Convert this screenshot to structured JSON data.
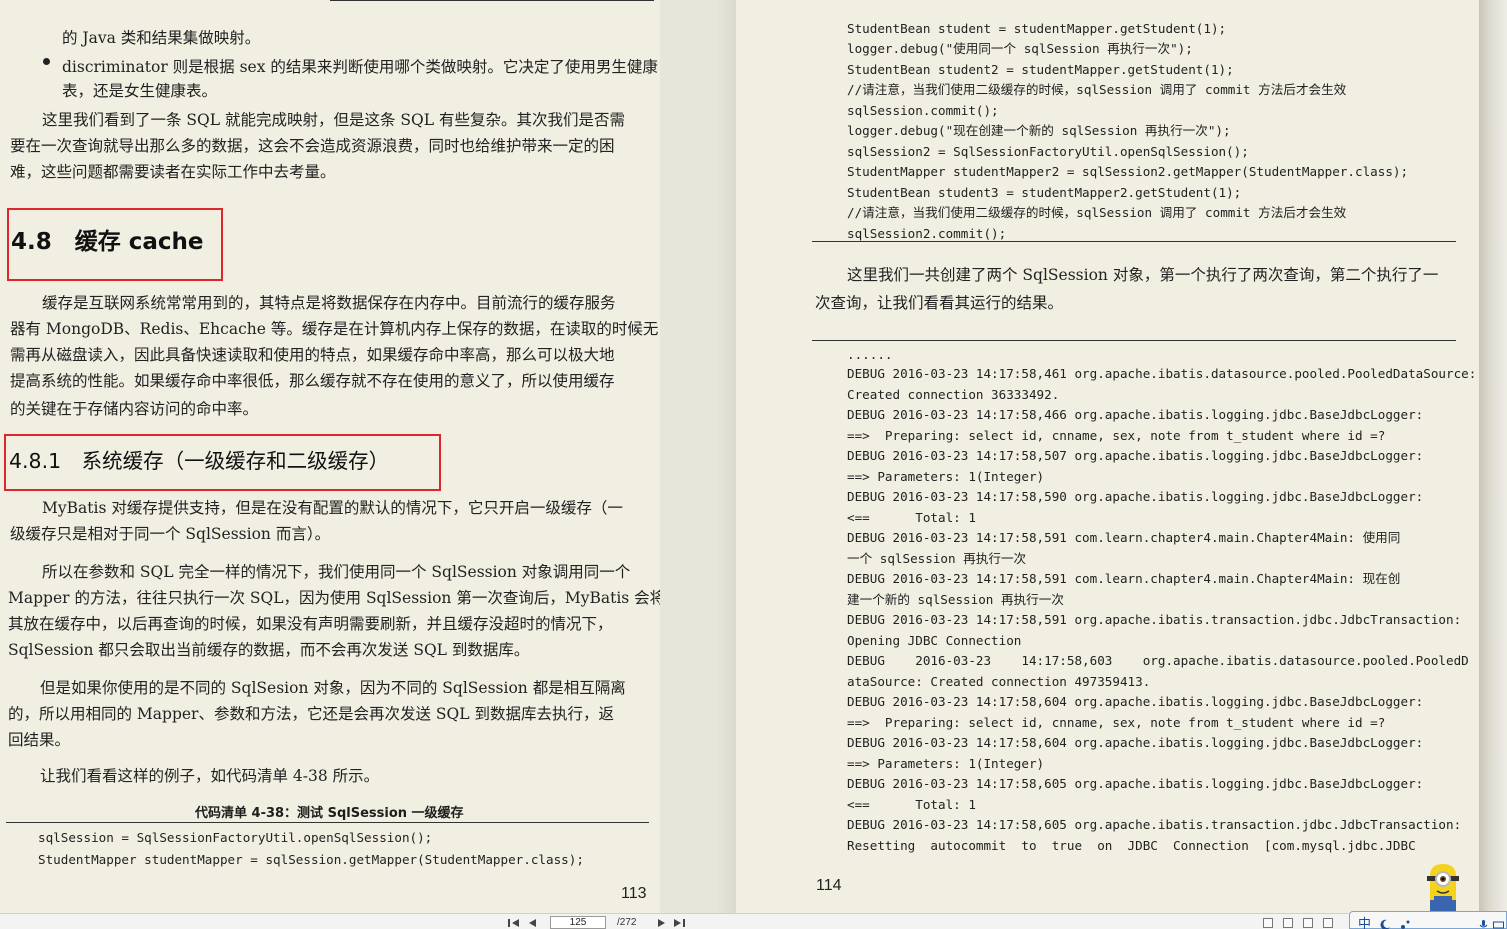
{
  "left_page": {
    "paragraphs": {
      "l1": "的 Java 类和结果集做映射。",
      "l2": "discriminator 则是根据 sex 的结果来判断使用哪个类做映射。它决定了使用男生健康",
      "l3": "表，还是女生健康表。",
      "l4": "这里我们看到了一条 SQL 就能完成映射，但是这条 SQL 有些复杂。其次我们是否需",
      "l5": "要在一次查询就导出那么多的数据，这会不会造成资源浪费，同时也给维护带来一定的困",
      "l6": "难，这些问题都需要读者在实际工作中去考量。",
      "l7": "缓存是互联网系统常常用到的，其特点是将数据保存在内存中。目前流行的缓存服务",
      "l8": "器有 MongoDB、Redis、Ehcache 等。缓存是在计算机内存上保存的数据，在读取的时候无",
      "l9": "需再从磁盘读入，因此具备快速读取和使用的特点，如果缓存命中率高，那么可以极大地",
      "l10": "提高系统的性能。如果缓存命中率很低，那么缓存就不存在使用的意义了，所以使用缓存",
      "l11": "的关键在于存储内容访问的命中率。",
      "l12": "MyBatis 对缓存提供支持，但是在没有配置的默认的情况下，它只开启一级缓存（一",
      "l13": "级缓存只是相对于同一个 SqlSession 而言）。",
      "l14": "所以在参数和 SQL 完全一样的情况下，我们使用同一个 SqlSession 对象调用同一个",
      "l15": "Mapper 的方法，往往只执行一次 SQL，因为使用 SqlSession 第一次查询后，MyBatis 会将",
      "l16": "其放在缓存中，以后再查询的时候，如果没有声明需要刷新，并且缓存没超时的情况下，",
      "l17": "SqlSession 都只会取出当前缓存的数据，而不会再次发送 SQL 到数据库。",
      "l18": "但是如果你使用的是不同的 SqlSesion 对象，因为不同的 SqlSession 都是相互隔离",
      "l19": "的，所以用相同的 Mapper、参数和方法，它还是会再次发送 SQL 到数据库去执行，返",
      "l20": "回结果。",
      "l21": "让我们看看这样的例子，如代码清单 4-38 所示。"
    },
    "heading_48": "4.8　缓存 cache",
    "heading_481": "4.8.1　系统缓存（一级缓存和二级缓存）",
    "caption": "代码清单 4-38：测试 SqlSession 一级缓存",
    "code": {
      "c1": "sqlSession = SqlSessionFactoryUtil.openSqlSession();",
      "c2": "StudentMapper studentMapper = sqlSession.getMapper(StudentMapper.class);"
    },
    "page_number": "113"
  },
  "right_page": {
    "code": {
      "c1": "StudentBean student = studentMapper.getStudent(1);",
      "c2": "logger.debug(\"使用同一个 sqlSession 再执行一次\");",
      "c3": "StudentBean student2 = studentMapper.getStudent(1);",
      "c4": "//请注意，当我们使用二级缓存的时候，sqlSession 调用了 commit 方法后才会生效",
      "c5": "sqlSession.commit();",
      "c6": "logger.debug(\"现在创建一个新的 sqlSession 再执行一次\");",
      "c7": "sqlSession2 = SqlSessionFactoryUtil.openSqlSession();",
      "c8": "StudentMapper studentMapper2 = sqlSession2.getMapper(StudentMapper.class);",
      "c9": "StudentBean student3 = studentMapper2.getStudent(1);",
      "c10": "//请注意，当我们使用二级缓存的时候，sqlSession 调用了 commit 方法后才会生效",
      "c11": "sqlSession2.commit();"
    },
    "paragraphs": {
      "p1": "这里我们一共创建了两个 SqlSession 对象，第一个执行了两次查询，第二个执行了一",
      "p2": "次查询，让我们看看其运行的结果。"
    },
    "log": {
      "g1": "......",
      "g2": "DEBUG 2016-03-23 14:17:58,461 org.apache.ibatis.datasource.pooled.PooledDataSource:",
      "g3": "Created connection 36333492.",
      "g4": "DEBUG 2016-03-23 14:17:58,466 org.apache.ibatis.logging.jdbc.BaseJdbcLogger:",
      "g5": "==>  Preparing: select id, cnname, sex, note from t_student where id =?",
      "g6": "DEBUG 2016-03-23 14:17:58,507 org.apache.ibatis.logging.jdbc.BaseJdbcLogger:",
      "g7": "==> Parameters: 1(Integer)",
      "g8": "DEBUG 2016-03-23 14:17:58,590 org.apache.ibatis.logging.jdbc.BaseJdbcLogger:",
      "g9": "<==      Total: 1",
      "g10": "DEBUG 2016-03-23 14:17:58,591 com.learn.chapter4.main.Chapter4Main: 使用同",
      "g11": "一个 sqlSession 再执行一次",
      "g12": "DEBUG 2016-03-23 14:17:58,591 com.learn.chapter4.main.Chapter4Main: 现在创",
      "g13": "建一个新的 sqlSession 再执行一次",
      "g14": "DEBUG 2016-03-23 14:17:58,591 org.apache.ibatis.transaction.jdbc.JdbcTransaction:",
      "g15": "Opening JDBC Connection",
      "g16": "DEBUG    2016-03-23    14:17:58,603    org.apache.ibatis.datasource.pooled.PooledD",
      "g17": "ataSource: Created connection 497359413.",
      "g18": "DEBUG 2016-03-23 14:17:58,604 org.apache.ibatis.logging.jdbc.BaseJdbcLogger:",
      "g19": "==>  Preparing: select id, cnname, sex, note from t_student where id =?",
      "g20": "DEBUG 2016-03-23 14:17:58,604 org.apache.ibatis.logging.jdbc.BaseJdbcLogger:",
      "g21": "==> Parameters: 1(Integer)",
      "g22": "DEBUG 2016-03-23 14:17:58,605 org.apache.ibatis.logging.jdbc.BaseJdbcLogger:",
      "g23": "<==      Total: 1",
      "g24": "DEBUG 2016-03-23 14:17:58,605 org.apache.ibatis.transaction.jdbc.JdbcTransaction:",
      "g25": "Resetting  autocommit  to  true  on  JDBC  Connection  [com.mysql.jdbc.JDBC"
    },
    "page_number": "114"
  },
  "toolbar": {
    "current_page": "125",
    "total_pages": "/272",
    "ime_label": "中"
  },
  "colors": {
    "highlight_box": "#e0262d",
    "page_background": "#f1efe1"
  }
}
